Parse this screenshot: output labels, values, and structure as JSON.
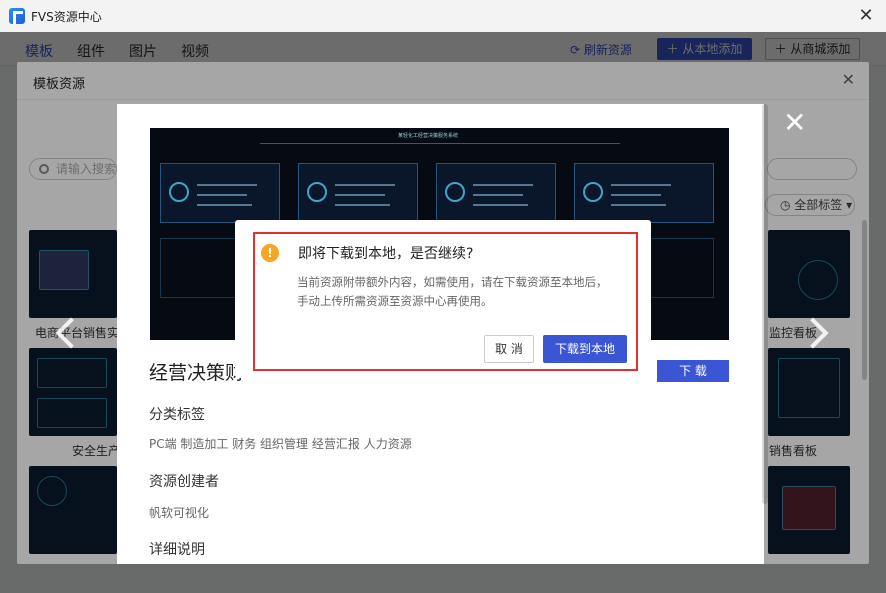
{
  "window": {
    "title": "FVS资源中心",
    "close_glyph": "✕"
  },
  "appbar": {
    "tabs": [
      {
        "label": "模板",
        "active": true
      },
      {
        "label": "组件",
        "active": false
      },
      {
        "label": "图片",
        "active": false
      },
      {
        "label": "视频",
        "active": false
      }
    ],
    "refresh_label": "刷新资源",
    "add_local_label": "从本地添加",
    "add_store_label": "从商城添加"
  },
  "panel": {
    "title": "模板资源",
    "search_placeholder": "请输入搜索",
    "tag_filter": "全部标签",
    "thumbs": [
      {
        "label": "电商平台销售实"
      },
      {
        "label": "安全生产"
      },
      {
        "label": "监控看板"
      },
      {
        "label": "销售看板"
      }
    ]
  },
  "preview": {
    "name": "经营决策财",
    "download_label": "下 载",
    "image_title": "某轻化工经营决策服务系统",
    "category_head": "分类标签",
    "category_tags": "PC端 制造加工 财务 组织管理 经营汇报 人力资源",
    "creator_head": "资源创建者",
    "creator": "帆软可视化",
    "detail_head": "详细说明"
  },
  "dialog": {
    "title": "即将下载到本地，是否继续?",
    "line1": "当前资源附带额外内容，如需使用，请在下载资源至本地后，",
    "line2": "手动上传所需资源至资源中心再使用。",
    "cancel_label": "取 消",
    "confirm_label": "下载到本地"
  },
  "colors": {
    "accent": "#3a56d4",
    "highlight": "#e0312f",
    "warning": "#f5a623"
  }
}
